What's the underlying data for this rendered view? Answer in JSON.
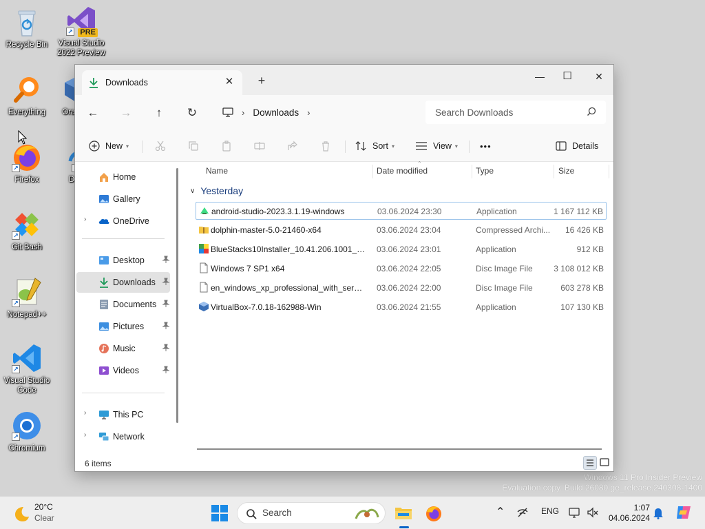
{
  "desktop": {
    "icons": [
      {
        "label": "Recycle Bin"
      },
      {
        "label": "Visual Studio 2022 Preview",
        "badge": "PRE"
      },
      {
        "label": "Everything"
      },
      {
        "label": "Ora Virt"
      },
      {
        "label": "Firefox"
      },
      {
        "label": "Do Sh"
      },
      {
        "label": "Git Bash"
      },
      {
        "label": "Notepad++"
      },
      {
        "label": "Visual Studio Code"
      },
      {
        "label": "Chromium"
      }
    ],
    "watermark": {
      "line1": "Windows 11 Pro Insider Preview",
      "line2": "Evaluation copy. Build 26080.ge_release.240308-1400"
    }
  },
  "explorer": {
    "tab": {
      "label": "Downloads",
      "close": "✕"
    },
    "new_tab": "+",
    "window_controls": {
      "minimize": "—",
      "maximize": "☐",
      "close": "✕"
    },
    "nav": {
      "back": "←",
      "forward": "→",
      "up": "↑",
      "refresh": "↻",
      "separator": "›"
    },
    "breadcrumb": [
      "Downloads"
    ],
    "search_placeholder": "Search Downloads",
    "commands": {
      "new": "New",
      "sort": "Sort",
      "view": "View",
      "more": "•••",
      "details": "Details"
    },
    "sidebar": {
      "quick": [
        {
          "label": "Home",
          "icon": "home-icon"
        },
        {
          "label": "Gallery",
          "icon": "gallery-icon"
        },
        {
          "label": "OneDrive",
          "icon": "onedrive-icon",
          "expandable": true
        }
      ],
      "pinned": [
        {
          "label": "Desktop",
          "icon": "desktop-folder-icon"
        },
        {
          "label": "Downloads",
          "icon": "downloads-folder-icon",
          "selected": true
        },
        {
          "label": "Documents",
          "icon": "documents-folder-icon"
        },
        {
          "label": "Pictures",
          "icon": "pictures-folder-icon"
        },
        {
          "label": "Music",
          "icon": "music-folder-icon"
        },
        {
          "label": "Videos",
          "icon": "videos-folder-icon"
        }
      ],
      "devices": [
        {
          "label": "This PC",
          "icon": "this-pc-icon",
          "expandable": true
        },
        {
          "label": "Network",
          "icon": "network-icon",
          "expandable": true
        }
      ]
    },
    "columns": {
      "name": "Name",
      "date": "Date modified",
      "type": "Type",
      "size": "Size"
    },
    "group": "Yesterday",
    "files": [
      {
        "name": "android-studio-2023.3.1.19-windows",
        "date": "03.06.2024 23:30",
        "type": "Application",
        "size": "1 167 112 KB",
        "icon": "android-studio-icon",
        "focused": true
      },
      {
        "name": "dolphin-master-5.0-21460-x64",
        "date": "03.06.2024 23:04",
        "type": "Compressed Archi...",
        "size": "16 426 KB",
        "icon": "archive-icon"
      },
      {
        "name": "BlueStacks10Installer_10.41.206.1001_nati...",
        "date": "03.06.2024 23:01",
        "type": "Application",
        "size": "912 KB",
        "icon": "bluestacks-icon"
      },
      {
        "name": "Windows 7 SP1 x64",
        "date": "03.06.2024 22:05",
        "type": "Disc Image File",
        "size": "3 108 012 KB",
        "icon": "disc-image-icon"
      },
      {
        "name": "en_windows_xp_professional_with_servic...",
        "date": "03.06.2024 22:00",
        "type": "Disc Image File",
        "size": "603 278 KB",
        "icon": "disc-image-icon"
      },
      {
        "name": "VirtualBox-7.0.18-162988-Win",
        "date": "03.06.2024 21:55",
        "type": "Application",
        "size": "107 130 KB",
        "icon": "virtualbox-icon"
      }
    ],
    "status": {
      "items": "6 items"
    }
  },
  "taskbar": {
    "weather": {
      "temp": "20°C",
      "condition": "Clear"
    },
    "search_label": "Search",
    "tray": {
      "lang": "ENG"
    },
    "clock": {
      "time": "1:07",
      "date": "04.06.2024"
    }
  },
  "colors": {
    "accent": "#0a64c8",
    "selection": "#e2e2e2",
    "focus_border": "#99c2ea",
    "group_header": "#1a3d7c"
  }
}
